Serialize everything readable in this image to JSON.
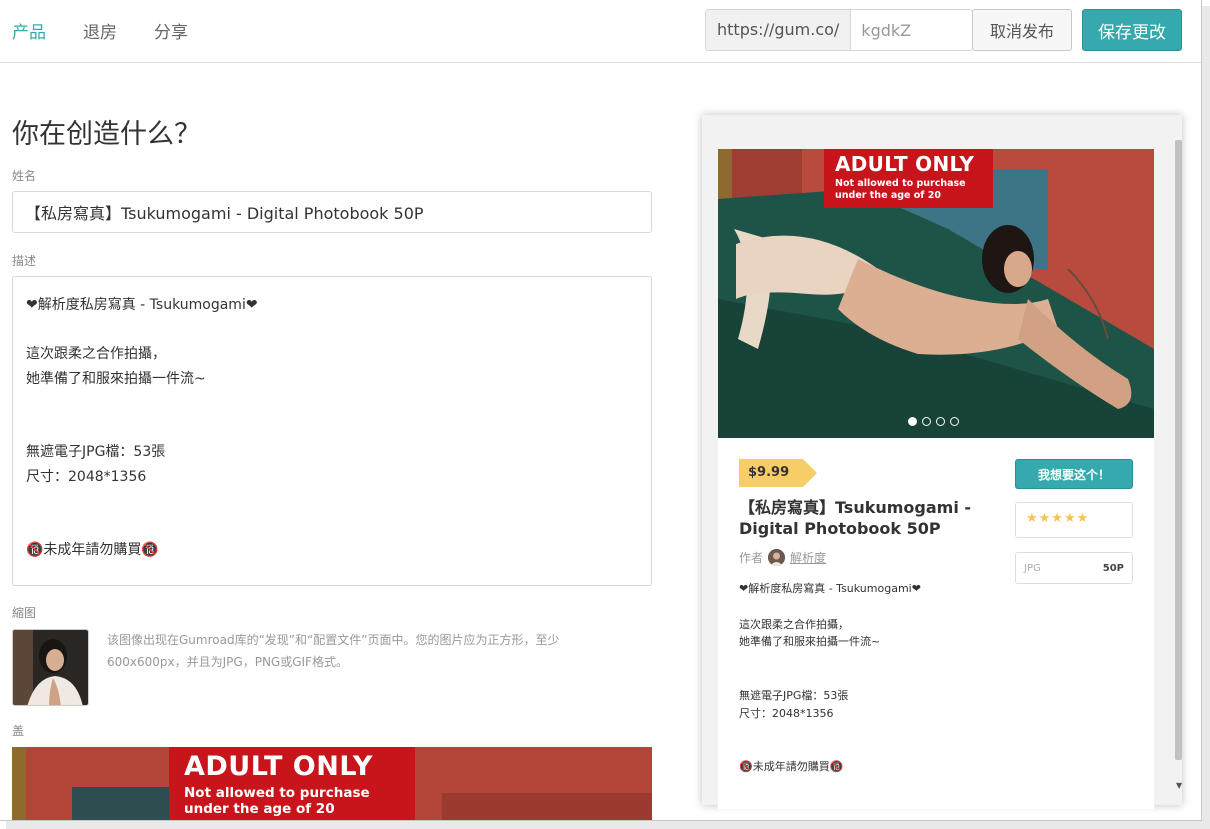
{
  "header": {
    "tabs": [
      {
        "label": "产品",
        "active": true
      },
      {
        "label": "退房",
        "active": false
      },
      {
        "label": "分享",
        "active": false
      }
    ],
    "url_prefix": "https://gum.co/",
    "url_slug": "kgdkZ",
    "unpublish_label": "取消发布",
    "save_label": "保存更改"
  },
  "form": {
    "title": "你在创造什么？",
    "name_label": "姓名",
    "name_value": "【私房寫真】Tsukumogami - Digital Photobook 50P",
    "description_label": "描述",
    "description_lines": [
      "❤解析度私房寫真 - Tsukumogami❤",
      "",
      "這次跟柔之合作拍攝，",
      "她準備了和服來拍攝一件流~",
      "",
      "",
      "無遮電子JPG檔：53張",
      "尺寸：2048*1356",
      "",
      "",
      "🔞未成年請勿購買🔞"
    ],
    "thumbnail_label": "縮图",
    "thumbnail_help": "该图像出现在Gumroad库的“发现”和“配置文件”页面中。您的图片应为正方形，至少600x600px，并且为JPG，PNG或GIF格式。",
    "cover_label": "盖"
  },
  "banner": {
    "heading": "ADULT ONLY",
    "subline1": "Not allowed to purchase",
    "subline2": "under the age of 20"
  },
  "preview": {
    "price": "$9.99",
    "title": "【私房寫真】Tsukumogami - Digital Photobook 50P",
    "author_prefix": "作者",
    "author_name": "解析度",
    "buy_label": "我想要这个！",
    "rating_stars": "★★★★★",
    "format_label": "JPG",
    "format_value": "50P",
    "carousel_count": 4,
    "carousel_active": 0,
    "description_lines": [
      "❤解析度私房寫真 - Tsukumogami❤",
      "",
      "這次跟柔之合作拍攝，",
      "她準備了和服來拍攝一件流~",
      "",
      "",
      "無遮電子JPG檔：53張",
      "尺寸：2048*1356",
      "",
      "",
      "🔞未成年請勿購買🔞"
    ]
  },
  "colors": {
    "accent": "#36a9ae",
    "price_tag": "#f7cd68",
    "banner_red": "#c8151b",
    "star": "#f4c451"
  }
}
